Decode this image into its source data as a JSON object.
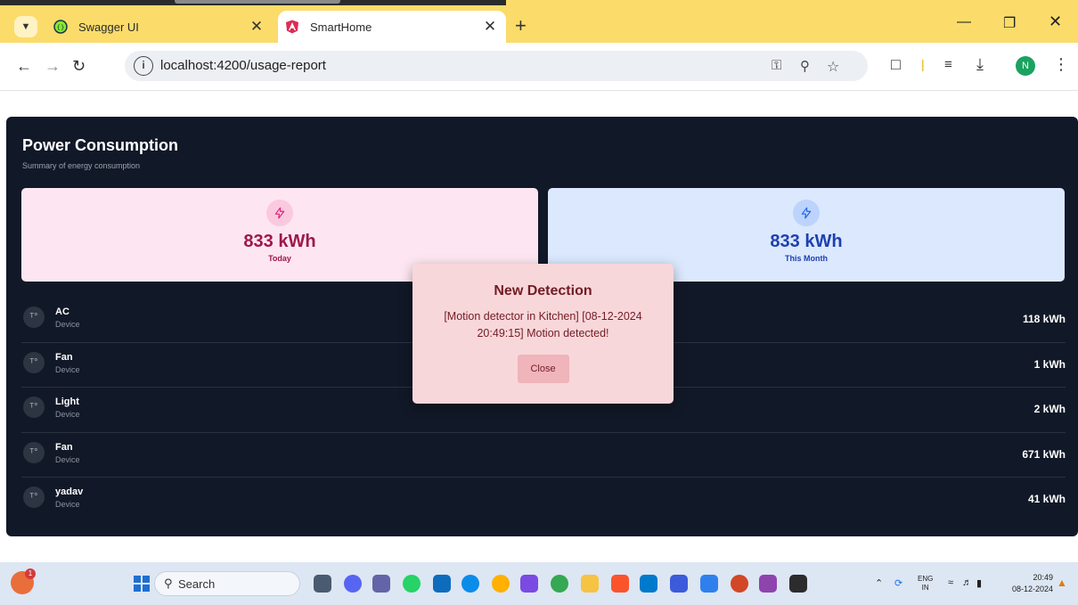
{
  "browser": {
    "tabs": [
      {
        "title": "Swagger UI",
        "active": false
      },
      {
        "title": "SmartHome",
        "active": true
      }
    ],
    "url": "localhost:4200/usage-report",
    "profile_initial": "N",
    "icons": {
      "tab_menu": "chevron-down-icon",
      "close": "close-icon",
      "new_tab": "plus-icon",
      "minimize": "minimize-icon",
      "restore": "restore-icon",
      "back": "arrow-left-icon",
      "forward": "arrow-right-icon",
      "reload": "reload-icon",
      "site_info": "info-icon",
      "password": "key-icon",
      "zoom": "zoom-icon",
      "bookmark": "star-icon",
      "extensions": "puzzle-icon",
      "reading_list": "playlist-icon",
      "downloads": "download-icon",
      "menu": "kebab-menu-icon"
    }
  },
  "page": {
    "title": "Power Consumption",
    "subtitle": "Summary of energy consumption",
    "stats": {
      "today": {
        "value": "833 kWh",
        "label": "Today",
        "icon": "bolt-icon"
      },
      "month": {
        "value": "833 kWh",
        "label": "This Month",
        "icon": "bolt-icon"
      }
    },
    "devices": [
      {
        "name": "AC",
        "type": "Device",
        "usage": "118 kWh"
      },
      {
        "name": "Fan",
        "type": "Device",
        "usage": "1 kWh"
      },
      {
        "name": "Light",
        "type": "Device",
        "usage": "2 kWh"
      },
      {
        "name": "Fan",
        "type": "Device",
        "usage": "671 kWh"
      },
      {
        "name": "yadav",
        "type": "Device",
        "usage": "41 kWh"
      }
    ]
  },
  "modal": {
    "title": "New Detection",
    "message": "[Motion detector in Kitchen] [08-12-2024 20:49:15] Motion detected!",
    "close_label": "Close"
  },
  "taskbar": {
    "search_label": "Search",
    "widget_badge": "1",
    "language_top": "ENG",
    "language_bottom": "IN",
    "time": "20:49",
    "date": "08-12-2024"
  },
  "colors": {
    "tabbar": "#fbdc6a",
    "card_bg": "#111827",
    "today_bg": "#fde6f1",
    "today_text": "#9d174d",
    "month_bg": "#dbe8fe",
    "month_text": "#1e40af",
    "modal_bg": "#f8d7da",
    "modal_text": "#721c24"
  }
}
